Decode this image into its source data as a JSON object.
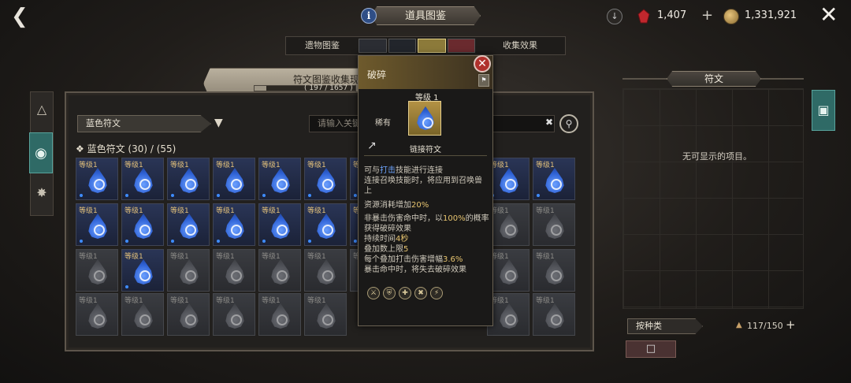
{
  "header": {
    "title": "道具图鉴",
    "currency_red": "1,407",
    "currency_gold": "1,331,921"
  },
  "tabs": {
    "left": "遗物图鉴",
    "right": "收集效果"
  },
  "collection": {
    "title": "符文图鉴收集现状",
    "count": "( 197 / 1657 )",
    "progress_fraction": 0.119
  },
  "filter": {
    "selected": "蓝色符文",
    "search_placeholder": "请输入关键"
  },
  "section": {
    "label": "蓝色符文 (30) / (55)"
  },
  "grid": {
    "rows": [
      [
        "等级1",
        "等级1",
        "等级1",
        "等级1",
        "等级1",
        "等级1",
        "等级1",
        "",
        "",
        "等级1",
        "等级1"
      ],
      [
        "等级1",
        "等级1",
        "等级1",
        "等级1",
        "等级1",
        "等级1",
        "等级1",
        "",
        "",
        "等级1",
        "等级1"
      ],
      [
        "等级1",
        "等级1",
        "等级1",
        "等级1",
        "等级1",
        "等级1",
        "等级1",
        "",
        "",
        "等级1",
        "等级1"
      ],
      [
        "等级1",
        "等级1",
        "等级1",
        "等级1",
        "等级1",
        "等级1",
        "",
        "",
        "",
        "等级1",
        "等级1"
      ]
    ],
    "state": [
      [
        "on",
        "on",
        "on",
        "on",
        "on",
        "on",
        "on",
        "",
        "",
        "on",
        "on"
      ],
      [
        "on",
        "on",
        "on",
        "on",
        "on",
        "on",
        "on",
        "",
        "",
        "off",
        "off"
      ],
      [
        "off",
        "on",
        "off",
        "off",
        "off",
        "off",
        "off",
        "",
        "",
        "off",
        "off"
      ],
      [
        "off",
        "off",
        "off",
        "off",
        "off",
        "off",
        "",
        "",
        "",
        "off",
        "off"
      ]
    ]
  },
  "tooltip": {
    "name": "破碎",
    "level": "等级 1",
    "rarity": "稀有",
    "type": "链接符文",
    "desc_line1_pre": "可与",
    "desc_line1_hl": "打击",
    "desc_line1_post": "技能进行连接",
    "desc_line2": "连接召唤技能时，将应用到召唤兽",
    "desc_line3": "上",
    "cost_pre": "资源消耗增加",
    "cost_val": "20%",
    "eff1_pre": "非暴击伤害命中时，以",
    "eff1_val": "100%",
    "eff1_post": "的概率",
    "eff2": "获得破碎效果",
    "eff3_pre": "持续时间",
    "eff3_val": "4秒",
    "eff4_pre": "叠加数上限",
    "eff4_val": "5",
    "eff5_pre": "每个叠加打击伤害增幅",
    "eff5_val": "3.6%",
    "eff6": "暴击命中时，将失去破碎效果"
  },
  "right_panel": {
    "title": "符文",
    "empty_text": "无可显示的项目。",
    "sort_label": "按种类",
    "capacity": "117/150"
  },
  "icons": {
    "back": "back-arrow-icon",
    "close": "close-icon",
    "info": "info-icon",
    "filter": "filter-funnel-icon",
    "search": "magnifier-icon"
  },
  "colors": {
    "accent_blue": "#3e8cff",
    "teal_tab": "#2f6a66",
    "tooltip_close": "#b0312c"
  }
}
